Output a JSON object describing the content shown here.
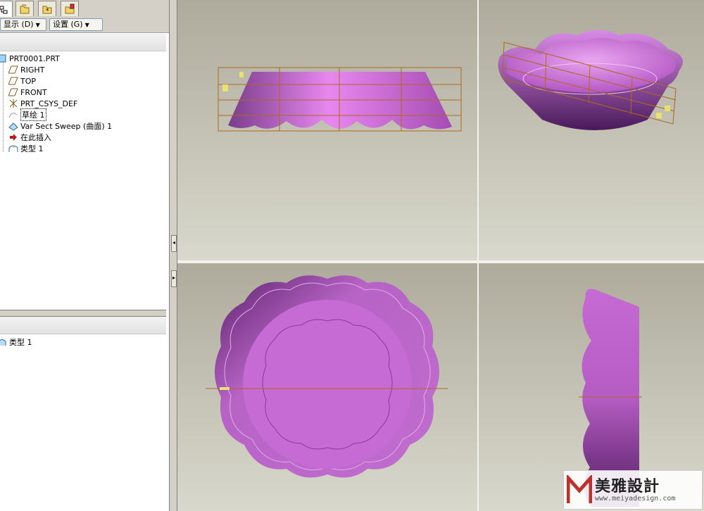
{
  "menus": {
    "show": "显示 (D)",
    "settings": "设置 (G)"
  },
  "tree": {
    "root": "PRT0001.PRT",
    "items": [
      "RIGHT",
      "TOP",
      "FRONT",
      "PRT_CSYS_DEF",
      "草绘 1",
      "Var Sect Sweep (曲面) 1",
      "在此插入",
      "类型 1"
    ]
  },
  "lower_tree": {
    "item": "类型 1"
  },
  "watermark": {
    "brand": "美雅設計",
    "url": "www.meiyadesign.com"
  },
  "colors": {
    "part": "#c66ad4",
    "part_dark": "#6a2a7a",
    "datum": "#b06820",
    "viewport_top": "#aeab9c",
    "viewport_bottom": "#d8d8cc"
  }
}
